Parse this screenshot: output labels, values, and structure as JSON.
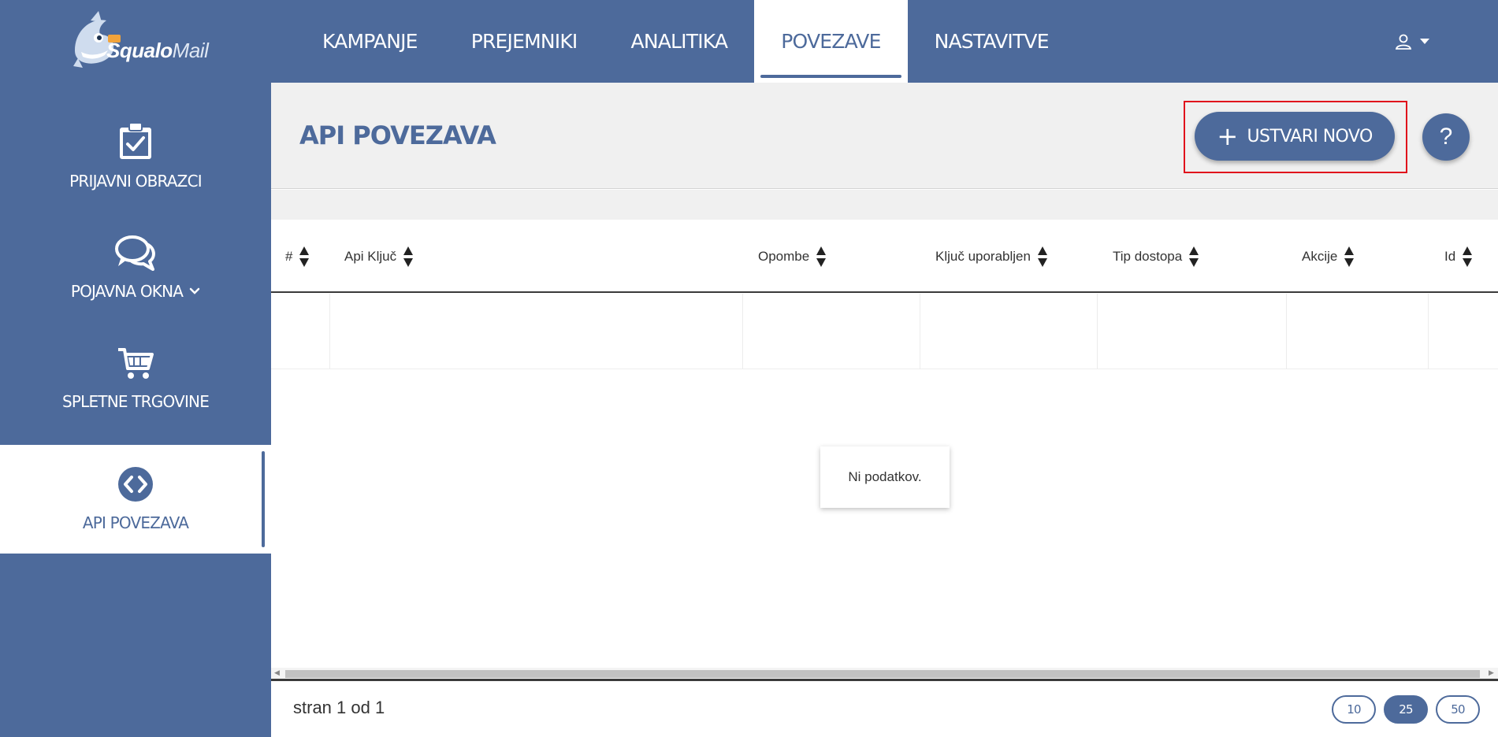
{
  "brand": {
    "logo_bold": "Squalo",
    "logo_light": "Mail"
  },
  "nav": {
    "items": [
      {
        "label": "KAMPANJE"
      },
      {
        "label": "PREJEMNIKI"
      },
      {
        "label": "ANALITIKA"
      },
      {
        "label": "POVEZAVE",
        "active": true
      },
      {
        "label": "NASTAVITVE"
      }
    ],
    "user_icon": "user-icon"
  },
  "sidebar": {
    "items": [
      {
        "label": "PRIJAVNI OBRAZCI",
        "icon": "clipboard-check-icon"
      },
      {
        "label": "POJAVNA OKNA",
        "icon": "chat-bubbles-icon",
        "has_dropdown": true
      },
      {
        "label": "SPLETNE TRGOVINE",
        "icon": "shopping-cart-icon"
      },
      {
        "label": "API POVEZAVA",
        "icon": "code-icon",
        "active": true
      }
    ]
  },
  "main": {
    "title": "API POVEZAVA",
    "create_label": "USTVARI NOVO",
    "help_label": "?"
  },
  "table": {
    "columns": [
      "#",
      "Api Ključ",
      "Opombe",
      "Ključ uporabljen",
      "Tip dostopa",
      "Akcije",
      "Id"
    ],
    "rows": [],
    "empty_message": "Ni podatkov."
  },
  "footer": {
    "page_info": "stran 1 od 1",
    "page_sizes": [
      "10",
      "25",
      "50"
    ],
    "selected_page_size": "25"
  },
  "colors": {
    "primary": "#4d6a9b",
    "highlight": "#e0121c"
  }
}
